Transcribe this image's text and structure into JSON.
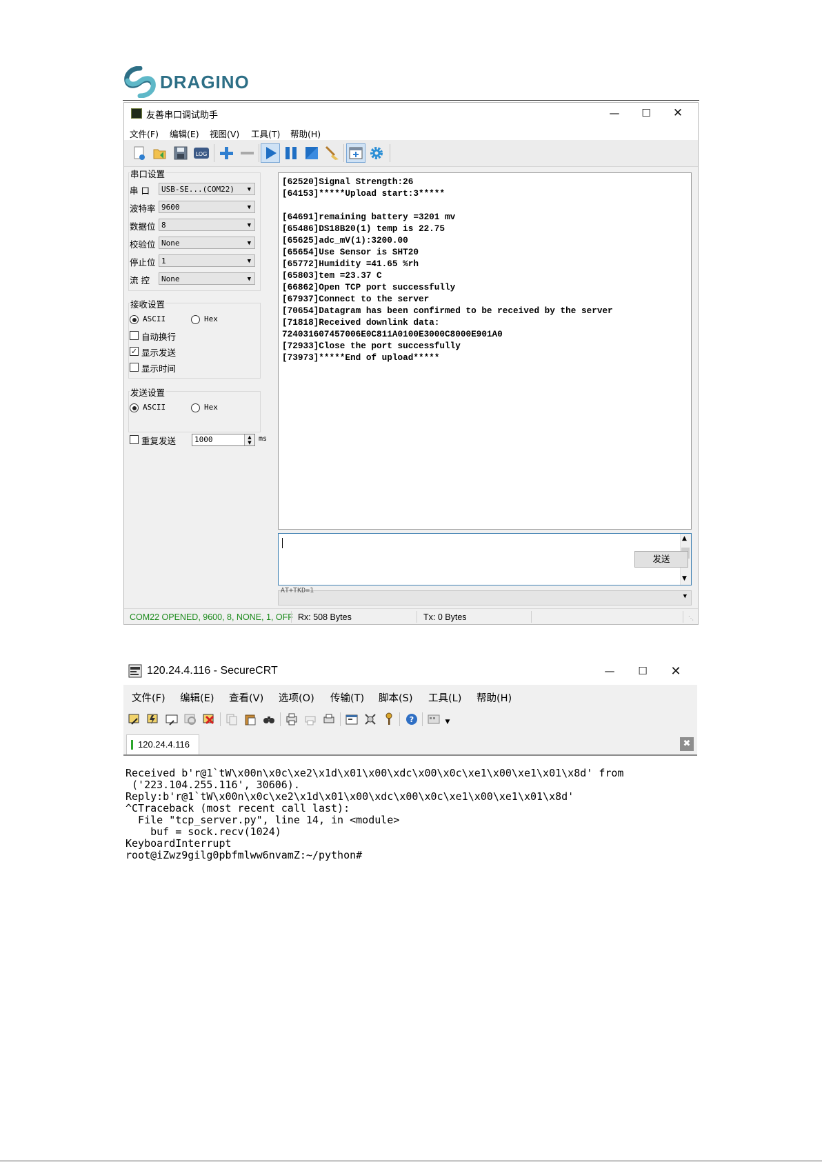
{
  "logo": {
    "text": "DRAGINO"
  },
  "serial": {
    "title": "友善串口调试助手",
    "menu": [
      "文件(F)",
      "编辑(E)",
      "视图(V)",
      "工具(T)",
      "帮助(H)"
    ],
    "toolbar": [
      {
        "name": "new-icon"
      },
      {
        "name": "open-icon"
      },
      {
        "name": "save-icon"
      },
      {
        "name": "log-icon",
        "label": "LOG"
      },
      {
        "name": "add-icon"
      },
      {
        "name": "remove-icon"
      },
      {
        "name": "play-icon"
      },
      {
        "name": "pause-icon"
      },
      {
        "name": "stop-icon"
      },
      {
        "name": "clear-icon"
      },
      {
        "name": "new-window-icon"
      },
      {
        "name": "settings-icon"
      }
    ],
    "port_settings": {
      "title": "串口设置",
      "rows": [
        {
          "label": "串  口",
          "value": "USB-SE...(COM22)"
        },
        {
          "label": "波特率",
          "value": "9600"
        },
        {
          "label": "数据位",
          "value": "8"
        },
        {
          "label": "校验位",
          "value": "None"
        },
        {
          "label": "停止位",
          "value": "1"
        },
        {
          "label": "流  控",
          "value": "None"
        }
      ]
    },
    "receive_settings": {
      "title": "接收设置",
      "ascii": "ASCII",
      "hex": "Hex",
      "auto_wrap": "自动换行",
      "show_send": "显示发送",
      "show_time": "显示时间"
    },
    "send_settings": {
      "title": "发送设置",
      "ascii": "ASCII",
      "hex": "Hex",
      "repeat": "重复发送",
      "interval": "1000",
      "unit": "ms"
    },
    "receive_text": "[62520]Signal Strength:26\n[64153]*****Upload start:3*****\n\n[64691]remaining battery =3201 mv\n[65486]DS18B20(1) temp is 22.75\n[65625]adc_mV(1):3200.00\n[65654]Use Sensor is SHT20\n[65772]Humidity =41.65 %rh\n[65803]tem =23.37 C\n[66862]Open TCP port successfully\n[67937]Connect to the server\n[70654]Datagram has been confirmed to be received by the server\n[71818]Received downlink data:\n724031607457006E0C811A0100E3000C8000E901A0\n[72933]Close the port successfully\n[73973]*****End of upload*****",
    "send_button": "发送",
    "history_value": "AT+TKD=1",
    "status": {
      "port": "COM22 OPENED, 9600, 8, NONE, 1, OFF",
      "rx": "Rx: 508 Bytes",
      "tx": "Tx: 0 Bytes"
    },
    "colors": {
      "status_ok": "#1a8a1a",
      "accent": "#2f7fd0"
    }
  },
  "crt": {
    "title": "120.24.4.116 - SecureCRT",
    "menu": [
      "文件(F)",
      "编辑(E)",
      "查看(V)",
      "选项(O)",
      "传输(T)",
      "脚本(S)",
      "工具(L)",
      "帮助(H)"
    ],
    "tab_label": "120.24.4.116",
    "terminal_text": "Received b'r@1`tW\\x00n\\x0c\\xe2\\x1d\\x01\\x00\\xdc\\x00\\x0c\\xe1\\x00\\xe1\\x01\\x8d' from\n ('223.104.255.116', 30606).\nReply:b'r@1`tW\\x00n\\x0c\\xe2\\x1d\\x01\\x00\\xdc\\x00\\x0c\\xe1\\x00\\xe1\\x01\\x8d'\n^CTraceback (most recent call last):\n  File \"tcp_server.py\", line 14, in <module>\n    buf = sock.recv(1024)\nKeyboardInterrupt\nroot@iZwz9gilg0pbfmlww6nvamZ:~/python#"
  }
}
